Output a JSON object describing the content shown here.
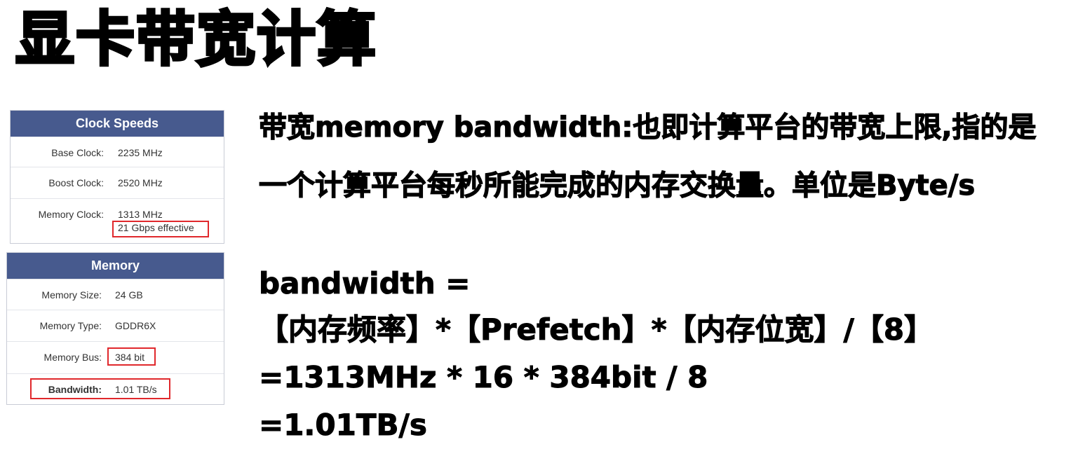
{
  "title": "显卡带宽计算",
  "clock_speeds": {
    "header": "Clock Speeds",
    "rows": [
      {
        "label": "Base Clock:",
        "value": "2235 MHz"
      },
      {
        "label": "Boost Clock:",
        "value": "2520 MHz"
      },
      {
        "label": "Memory Clock:",
        "value": "1313 MHz",
        "sub": "21 Gbps effective"
      }
    ]
  },
  "memory": {
    "header": "Memory",
    "rows": [
      {
        "label": "Memory Size:",
        "value": "24 GB"
      },
      {
        "label": "Memory Type:",
        "value": "GDDR6X"
      },
      {
        "label": "Memory Bus:",
        "value": "384 bit"
      },
      {
        "label": "Bandwidth:",
        "value": "1.01 TB/s"
      }
    ]
  },
  "description": {
    "line1": "带宽memory bandwidth:也即计算平台的带宽上限,指的是",
    "line2": "一个计算平台每秒所能完成的内存交换量。单位是Byte/s"
  },
  "formula": {
    "line1": "bandwidth =",
    "line2": "【内存频率】*【Prefetch】*【内存位宽】/【8】",
    "line3": "=1313MHz * 16 * 384bit / 8",
    "line4": "=1.01TB/s"
  },
  "colors": {
    "header_bg": "#475a8e",
    "highlight_box": "#e0282c"
  }
}
